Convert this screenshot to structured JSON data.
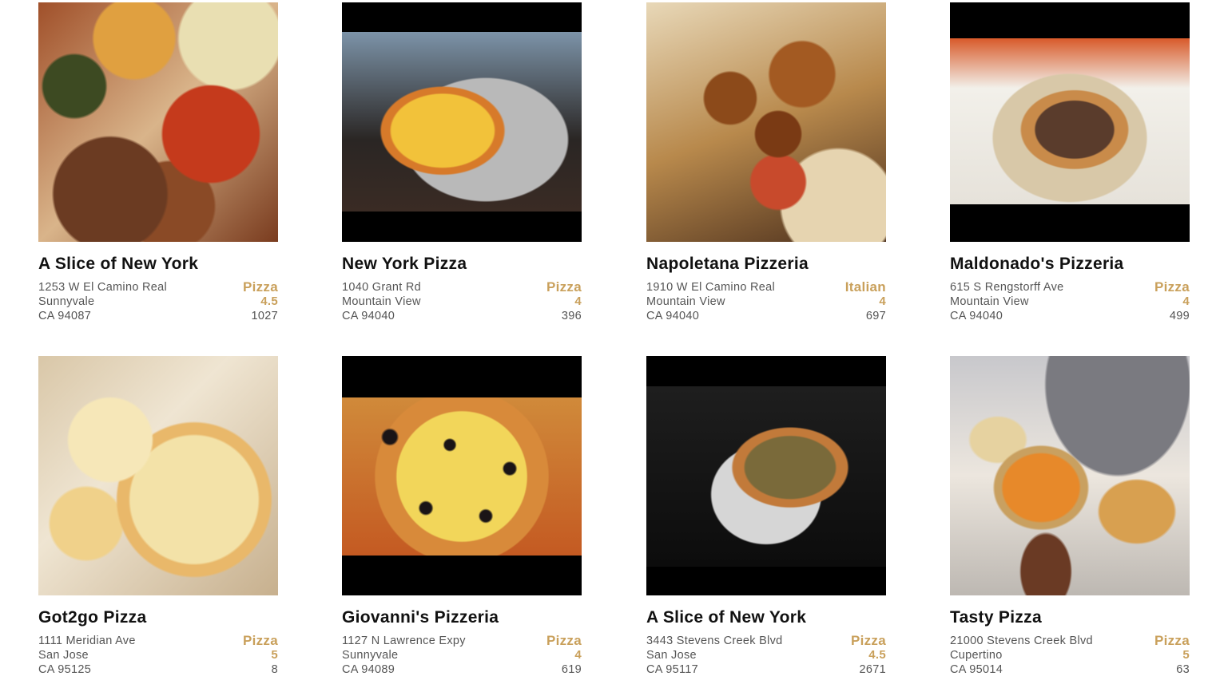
{
  "restaurants": [
    {
      "name": "A Slice of New York",
      "address": "1253 W El Camino Real",
      "city": "Sunnyvale",
      "state_zip": "CA 94087",
      "category": "Pizza",
      "rating": "4.5",
      "reviews": "1027",
      "photo_icon": "pizza-slices-box-photo"
    },
    {
      "name": "New York Pizza",
      "address": "1040 Grant Rd",
      "city": "Mountain View",
      "state_zip": "CA 94040",
      "category": "Pizza",
      "rating": "4",
      "reviews": "396",
      "photo_icon": "pineapple-pizza-photo"
    },
    {
      "name": "Napoletana Pizzeria",
      "address": "1910 W El Camino Real",
      "city": "Mountain View",
      "state_zip": "CA 94040",
      "category": "Italian",
      "rating": "4",
      "reviews": "697",
      "photo_icon": "neapolitan-pizza-closeup-photo"
    },
    {
      "name": "Maldonado's Pizzeria",
      "address": "615 S Rengstorff Ave",
      "city": "Mountain View",
      "state_zip": "CA 94040",
      "category": "Pizza",
      "rating": "4",
      "reviews": "499",
      "photo_icon": "pizza-in-box-photo"
    },
    {
      "name": "Got2go Pizza",
      "address": "1111 Meridian Ave",
      "city": "San Jose",
      "state_zip": "CA 95125",
      "category": "Pizza",
      "rating": "5",
      "reviews": "8",
      "photo_icon": "cheese-pizza-pull-photo"
    },
    {
      "name": "Giovanni's Pizzeria",
      "address": "1127 N Lawrence Expy",
      "city": "Sunnyvale",
      "state_zip": "CA 94089",
      "category": "Pizza",
      "rating": "4",
      "reviews": "619",
      "photo_icon": "olive-pizza-photo"
    },
    {
      "name": "A Slice of New York",
      "address": "3443 Stevens Creek Blvd",
      "city": "San Jose",
      "state_zip": "CA 95117",
      "category": "Pizza",
      "rating": "4.5",
      "reviews": "2671",
      "photo_icon": "pizza-slice-plate-photo"
    },
    {
      "name": "Tasty Pizza",
      "address": "21000 Stevens Creek Blvd",
      "city": "Cupertino",
      "state_zip": "CA 95014",
      "category": "Pizza",
      "rating": "5",
      "reviews": "63",
      "photo_icon": "pizza-spread-photo"
    }
  ],
  "colors": {
    "accent": "#c9a05b",
    "title": "#111111",
    "text": "#555555"
  }
}
